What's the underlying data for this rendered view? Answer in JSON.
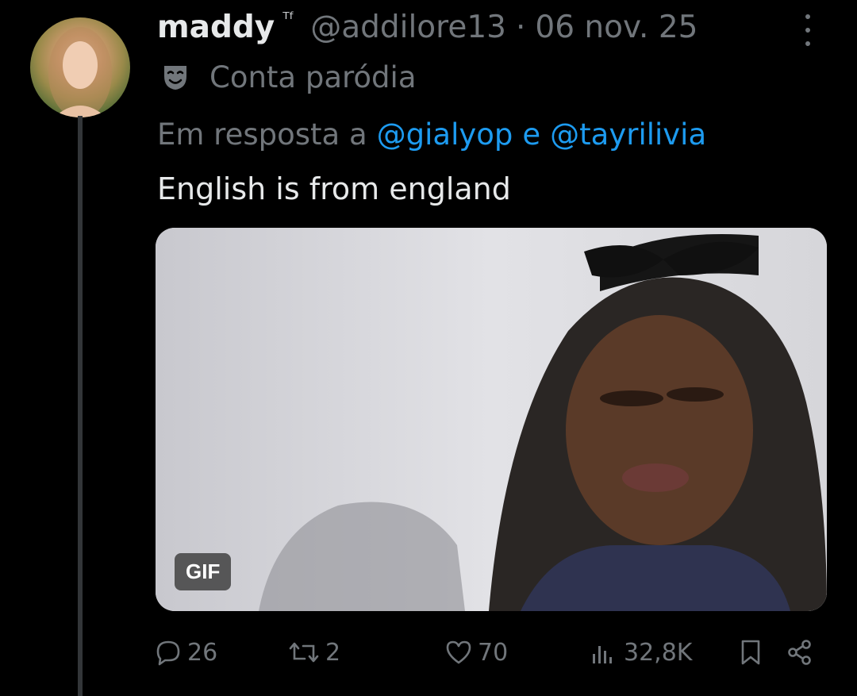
{
  "author": {
    "display_name": "maddy",
    "name_tag": "ᵀᶠ",
    "handle": "@addilore13",
    "separator": "·",
    "date": "06 nov. 25",
    "label": "Conta paródia"
  },
  "reply_context": {
    "prefix": "Em resposta a",
    "user1": "@gialyop",
    "conjunction": "e",
    "user2": "@tayrilivia"
  },
  "tweet": {
    "text": "English is from england",
    "media_badge": "GIF"
  },
  "actions": {
    "replies": "26",
    "retweets": "2",
    "likes": "70",
    "views": "32,8K"
  },
  "colors": {
    "background": "#000000",
    "text": "#e7e9ea",
    "muted": "#71767b",
    "link": "#1d9bf0"
  },
  "icons": [
    "more-vertical-icon",
    "theater-mask-icon",
    "reply-icon",
    "retweet-icon",
    "like-icon",
    "views-icon",
    "bookmark-icon",
    "share-icon"
  ]
}
